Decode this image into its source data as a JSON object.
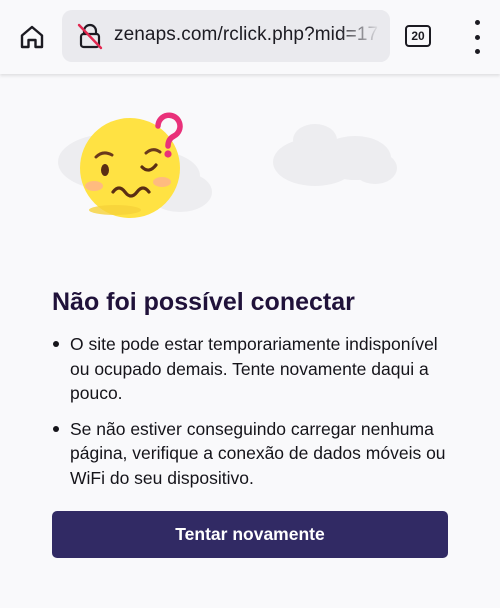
{
  "browser": {
    "url": "zenaps.com/rclick.php?mid=17",
    "tab_count": "20",
    "icons": {
      "home": "home-icon",
      "site_security": "insecure-lock-icon",
      "tabs": "tab-counter-icon",
      "menu": "more-vertical-icon"
    }
  },
  "error_page": {
    "title": "Não foi possível conectar",
    "bullets": [
      "O site pode estar temporariamente indisponível ou ocupado demais. Tente novamente daqui a pouco.",
      "Se não estiver conseguindo carregar nenhuma página, verifique a conexão de dados móveis ou WiFi do seu dispositivo."
    ],
    "retry_label": "Tentar novamente",
    "illustration": "confused-face-with-question-mark"
  },
  "colors": {
    "title": "#20123a",
    "button": "#312a64",
    "face": "#ffe243",
    "question_mark": "#e9317a",
    "insecure_slash": "#e22850"
  }
}
